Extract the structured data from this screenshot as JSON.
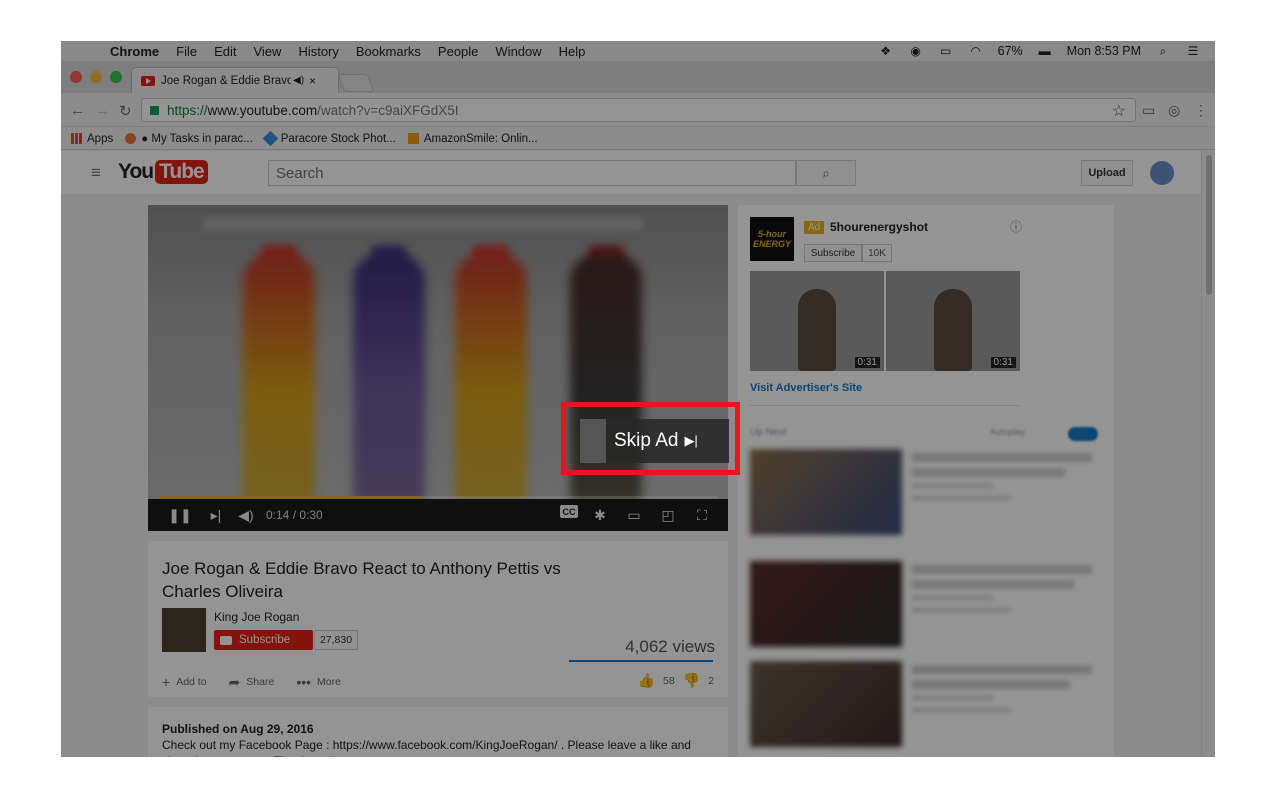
{
  "menubar": {
    "apple": "",
    "items": [
      "Chrome",
      "File",
      "Edit",
      "View",
      "History",
      "Bookmarks",
      "People",
      "Window",
      "Help"
    ],
    "battery": "67%",
    "clock": "Mon 8:53 PM"
  },
  "tab": {
    "title": "Joe Rogan & Eddie Bravo Re",
    "audio": "◀)",
    "close": "×"
  },
  "omnibox": {
    "https": "https://",
    "host": "www.youtube.com",
    "path": "/watch?v=c9aiXFGdX5I"
  },
  "bookmarks": [
    "Apps",
    "● My Tasks in parac...",
    "Paracore Stock Phot...",
    "AmazonSmile: Onlin..."
  ],
  "youtube": {
    "logo_you": "You",
    "logo_tube": "Tube",
    "search_placeholder": "Search",
    "upload_label": "Upload"
  },
  "player": {
    "skip_label": "Skip Ad",
    "skip_arrow": "▶|",
    "time": "0:14 / 0:30",
    "progress": 0.47,
    "cc_label": "CC"
  },
  "video": {
    "title": "Joe Rogan & Eddie Bravo React to Anthony Pettis vs Charles Oliveira",
    "channel": "King Joe Rogan",
    "subscribe_label": "Subscribe",
    "subscriber_count": "27,830",
    "views": "4,062 views",
    "add_to": "Add to",
    "share": "Share",
    "more": "More",
    "likes": "58",
    "dislikes": "2",
    "published": "Published on Aug 29, 2016",
    "description": "Check out my Facebook Page : https://www.facebook.com/KingJoeRogan/ . Please leave a like and share it to everyone. Thank you!"
  },
  "ad": {
    "logo_text": "5-hour ENERGY",
    "tag": "Ad",
    "name": "5hourenergyshot",
    "subscribe_label": "Subscribe",
    "subscriber_count": "10K",
    "durations": [
      "0:31",
      "0:31"
    ],
    "visit_label": "Visit Advertiser's Site"
  },
  "sidebar": {
    "up_next": "Up Next",
    "autoplay": "Autoplay"
  },
  "colors": {
    "youtube_red": "#e62117",
    "highlight_red": "#e5161d",
    "link_blue": "#167ac6",
    "progress_yellow": "#e1b42b"
  }
}
